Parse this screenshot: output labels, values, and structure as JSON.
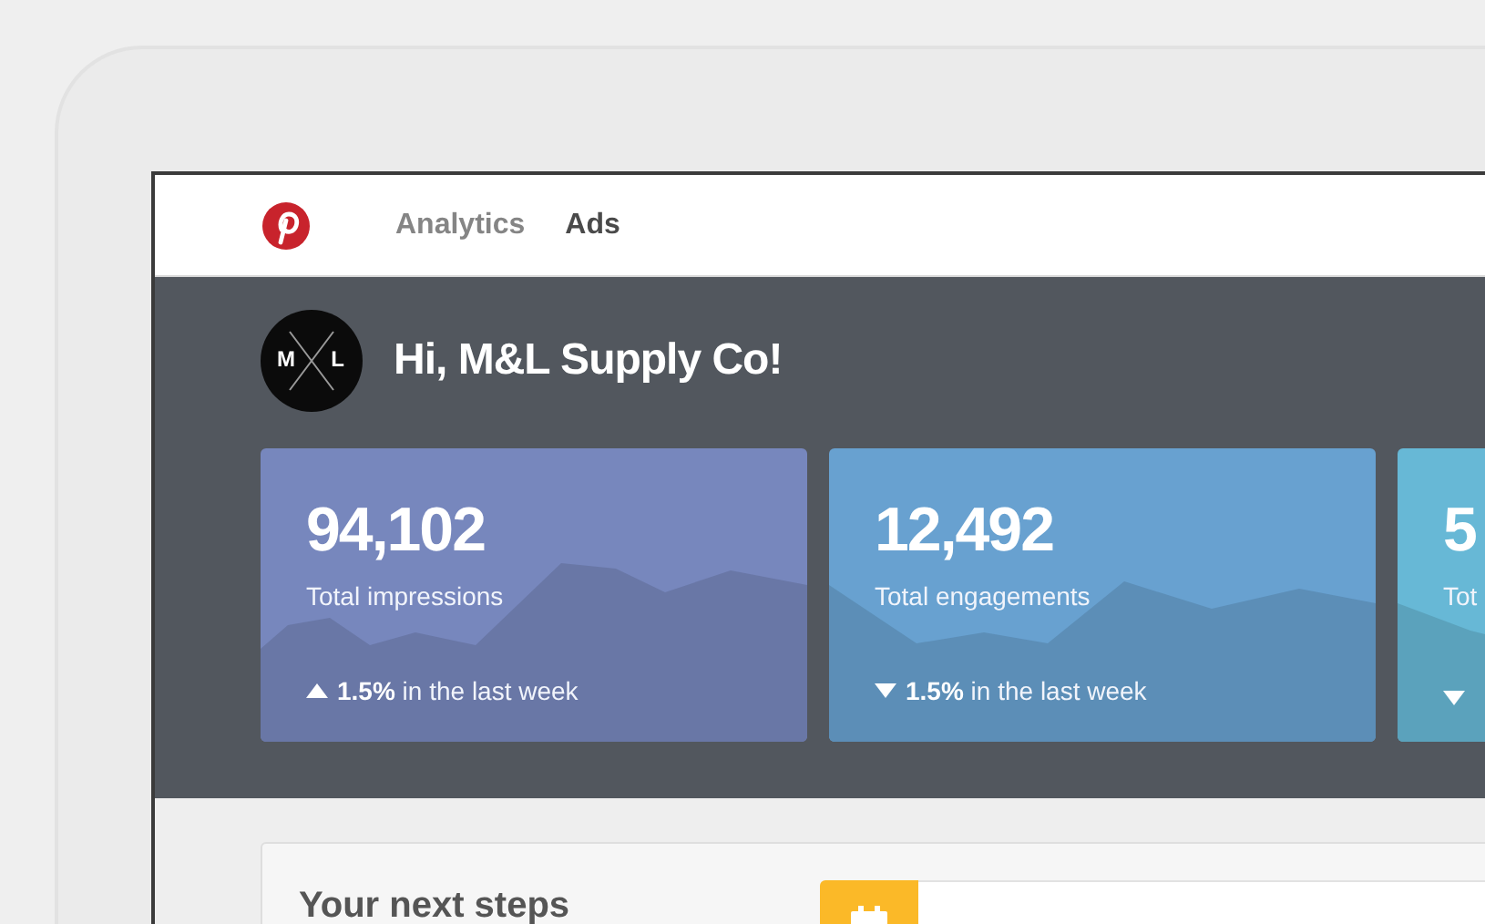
{
  "nav": {
    "items": [
      {
        "label": "Analytics",
        "selected": false
      },
      {
        "label": "Ads",
        "selected": true
      }
    ]
  },
  "header": {
    "avatar": {
      "left": "M",
      "right": "L"
    },
    "greeting": "Hi, M&L Supply Co!"
  },
  "stats": [
    {
      "value": "94,102",
      "label": "Total impressions",
      "kind": "up",
      "change": "**1.5%** in the last week",
      "color": "#7787bd"
    },
    {
      "value": "12,492",
      "label": "Total engagements",
      "kind": "down",
      "change": "**1.5%** in the last week",
      "color": "#68a1d0"
    },
    {
      "value": "5",
      "label": "Tot",
      "kind": "down",
      "color": "#67b8d6"
    }
  ],
  "next_steps": {
    "title": "Your next steps"
  }
}
